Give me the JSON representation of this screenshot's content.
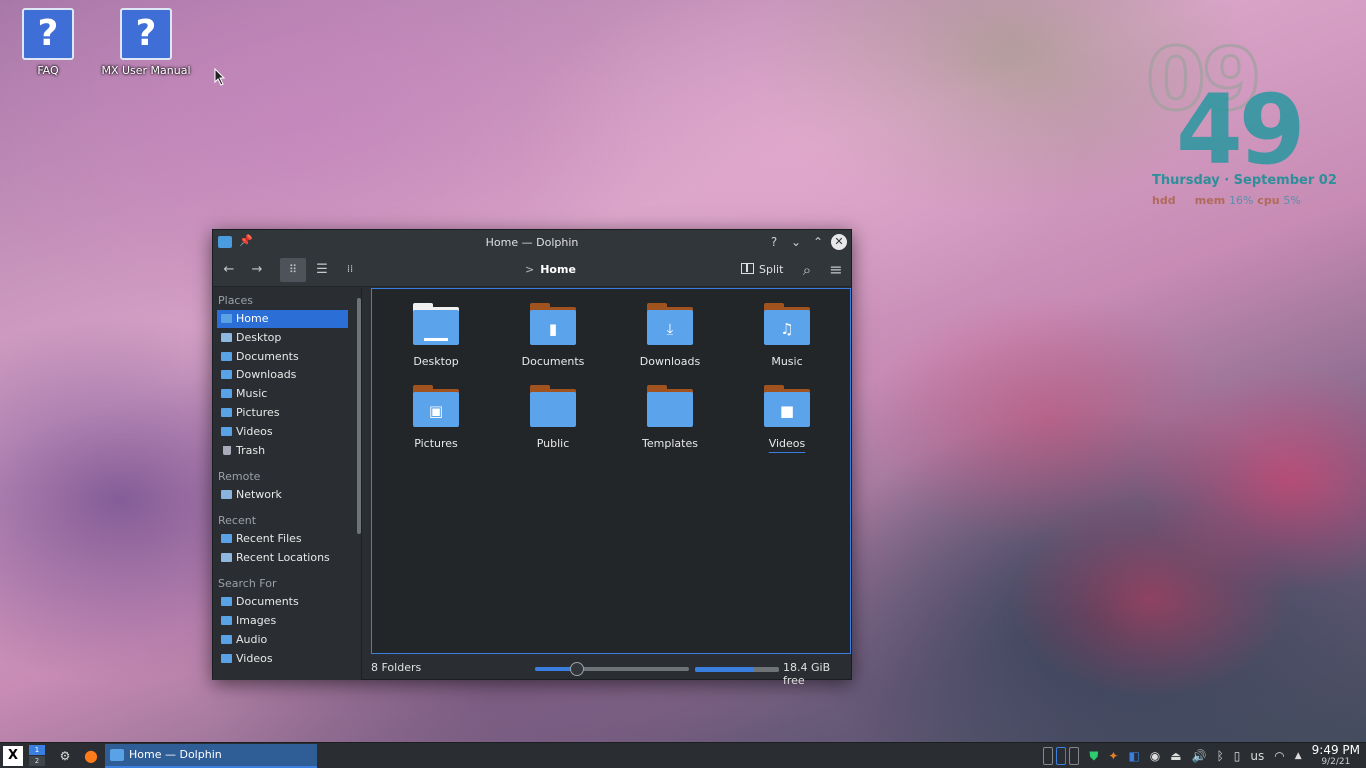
{
  "desktop": {
    "icons": [
      {
        "label": "FAQ",
        "glyph": "?"
      },
      {
        "label": "MX User Manual",
        "glyph": "?"
      }
    ]
  },
  "conky": {
    "hour": "09",
    "minute": "49",
    "date": "Thursday · September 02",
    "hdd_label": "hdd",
    "hdd_pct": "",
    "mem_label": "mem",
    "mem_pct": "16%",
    "cpu_label": "cpu",
    "cpu_pct": "5%"
  },
  "window": {
    "title": "Home — Dolphin",
    "buttons": {
      "help": "?",
      "minimize": "⌄",
      "maximize": "⌃",
      "close": "✕"
    },
    "toolbar": {
      "back": "←",
      "forward": "→",
      "view_icons": "⠿",
      "view_details": "☰",
      "view_compact": "⁞⁞",
      "breadcrumb_chevron": ">",
      "breadcrumb": "Home",
      "split_label": "Split",
      "search_icon": "⌕",
      "menu_icon": "≡"
    },
    "sidebar": {
      "places_title": "Places",
      "places": [
        {
          "label": "Home"
        },
        {
          "label": "Desktop"
        },
        {
          "label": "Documents"
        },
        {
          "label": "Downloads"
        },
        {
          "label": "Music"
        },
        {
          "label": "Pictures"
        },
        {
          "label": "Videos"
        },
        {
          "label": "Trash"
        }
      ],
      "remote_title": "Remote",
      "remote": [
        {
          "label": "Network"
        }
      ],
      "recent_title": "Recent",
      "recent": [
        {
          "label": "Recent Files"
        },
        {
          "label": "Recent Locations"
        }
      ],
      "search_title": "Search For",
      "search": [
        {
          "label": "Documents"
        },
        {
          "label": "Images"
        },
        {
          "label": "Audio"
        },
        {
          "label": "Videos"
        }
      ]
    },
    "folders": [
      {
        "label": "Desktop",
        "glyph": ""
      },
      {
        "label": "Documents",
        "glyph": "▮"
      },
      {
        "label": "Downloads",
        "glyph": "⤓"
      },
      {
        "label": "Music",
        "glyph": "♫"
      },
      {
        "label": "Pictures",
        "glyph": "▣"
      },
      {
        "label": "Public",
        "glyph": ""
      },
      {
        "label": "Templates",
        "glyph": ""
      },
      {
        "label": "Videos",
        "glyph": "■"
      }
    ],
    "status": {
      "count": "8 Folders",
      "zoom_fraction": 0.27,
      "space_used_fraction": 0.7,
      "free": "18.4 GiB free"
    }
  },
  "taskbar": {
    "start_label": "X",
    "pager": [
      "1",
      "2"
    ],
    "settings_icon": "⚙",
    "firefox_icon": "●",
    "task_title": "Home — Dolphin",
    "tray": {
      "volume_icon": "🔊",
      "bluetooth_icon": "ᛒ",
      "usb_icon": "▯",
      "keyboard": "us",
      "wifi_icon": "◠",
      "up_arrow": "▲",
      "eject_icon": "⏏"
    },
    "time": "9:49 PM",
    "date": "9/2/21"
  },
  "colors": {
    "accent": "#3a7fe0",
    "folder_blue": "#5ba3ea",
    "folder_tab": "#a0531f",
    "window_bg": "#2a2e32"
  }
}
